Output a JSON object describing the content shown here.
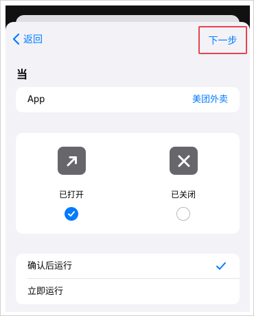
{
  "nav": {
    "back_label": "返回",
    "next_label": "下一步"
  },
  "section": {
    "title": "当"
  },
  "app_row": {
    "label": "App",
    "value": "美团外卖"
  },
  "states": {
    "open_label": "已打开",
    "closed_label": "已关闭",
    "selected": "已打开"
  },
  "run_options": {
    "items": [
      {
        "label": "确认后运行",
        "selected": true
      },
      {
        "label": "立即运行",
        "selected": false
      }
    ]
  },
  "colors": {
    "accent": "#007aff",
    "highlight_border": "#e8434e",
    "icon_tile": "#66666b",
    "sheet_bg": "#f2f2f7"
  }
}
